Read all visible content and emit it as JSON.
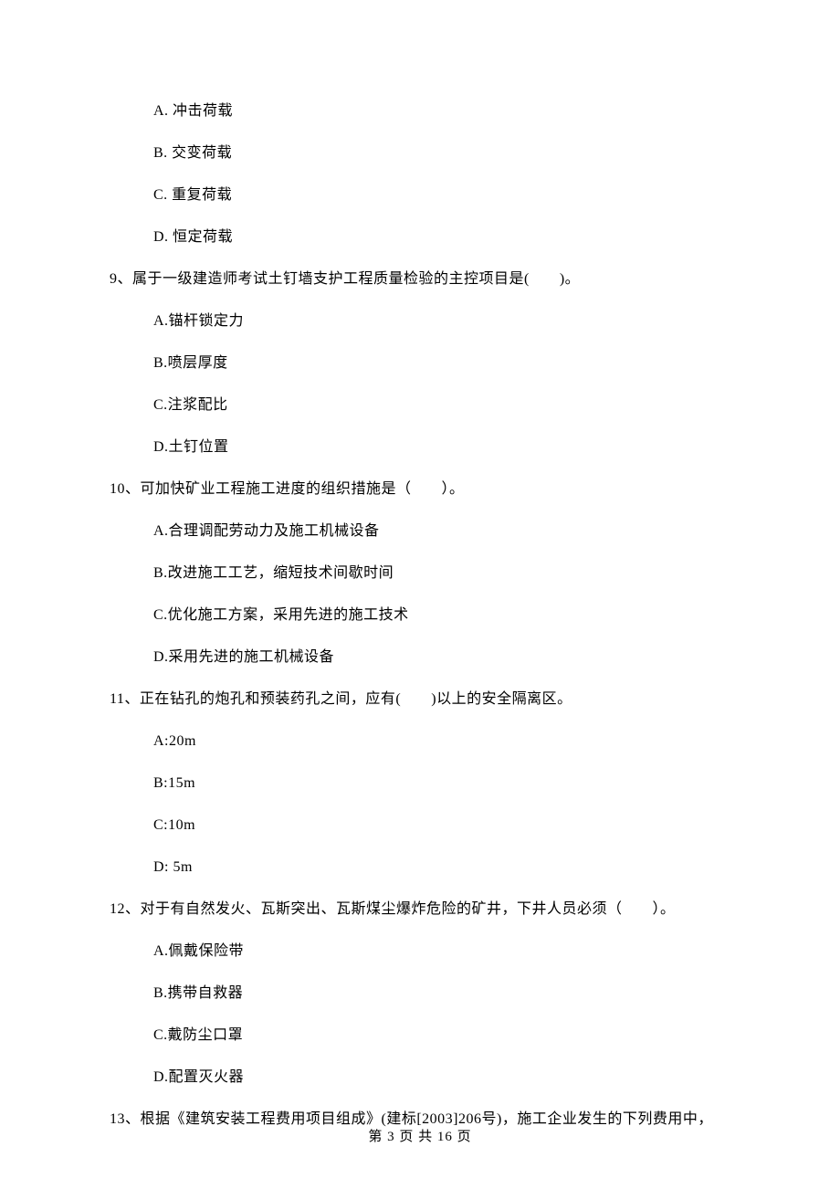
{
  "opts_pre": {
    "A": "A. 冲击荷载",
    "B": "B. 交变荷载",
    "C": "C. 重复荷载",
    "D": "D. 恒定荷载"
  },
  "q9": {
    "text": "9、属于一级建造师考试土钉墙支护工程质量检验的主控项目是(　　)。",
    "opts": {
      "A": "A.锚杆锁定力",
      "B": "B.喷层厚度",
      "C": "C.注浆配比",
      "D": "D.土钉位置"
    }
  },
  "q10": {
    "text": "10、可加快矿业工程施工进度的组织措施是（　　）。",
    "opts": {
      "A": "A.合理调配劳动力及施工机械设备",
      "B": "B.改进施工工艺，缩短技术间歇时间",
      "C": "C.优化施工方案，采用先进的施工技术",
      "D": "D.采用先进的施工机械设备"
    }
  },
  "q11": {
    "text": "11、正在钻孔的炮孔和预装药孔之间，应有(　　)以上的安全隔离区。",
    "opts": {
      "A": "A:20m",
      "B": "B:15m",
      "C": "C:10m",
      "D": "D: 5m"
    }
  },
  "q12": {
    "text": "12、对于有自然发火、瓦斯突出、瓦斯煤尘爆炸危险的矿井，下井人员必须（　　）。",
    "opts": {
      "A": "A.佩戴保险带",
      "B": "B.携带自救器",
      "C": "C.戴防尘口罩",
      "D": "D.配置灭火器"
    }
  },
  "q13": {
    "text": "13、根据《建筑安装工程费用项目组成》(建标[2003]206号)，施工企业发生的下列费用中，"
  },
  "footer": "第 3 页 共 16 页"
}
